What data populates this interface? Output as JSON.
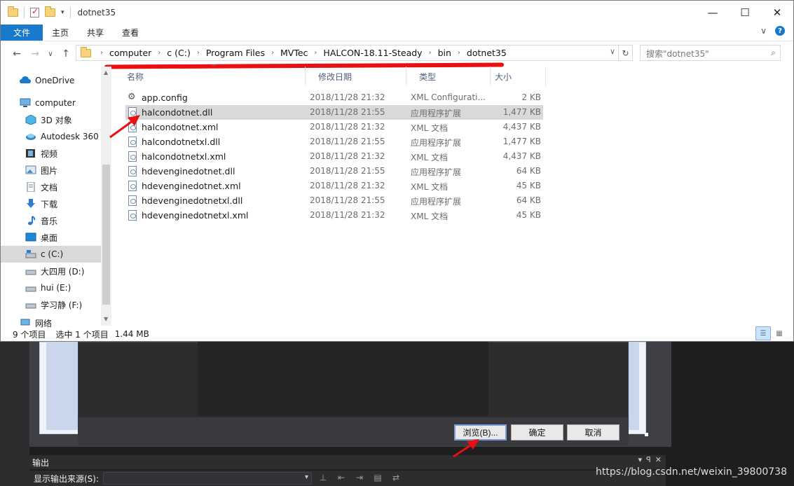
{
  "window": {
    "title": "dotnet35",
    "controls": {
      "minimize": "—",
      "maximize": "☐",
      "close": "✕"
    }
  },
  "ribbon": {
    "tabs": [
      "文件",
      "主页",
      "共享",
      "查看"
    ],
    "chevron": "∨",
    "help": "?"
  },
  "nav": {
    "back": "←",
    "forward": "→",
    "recent": "∨",
    "up": "↑",
    "breadcrumb": [
      "computer",
      "c (C:)",
      "Program Files",
      "MVTec",
      "HALCON-18.11-Steady",
      "bin",
      "dotnet35"
    ],
    "refresh": "↻",
    "search_placeholder": "搜索\"dotnet35\""
  },
  "sidebar": {
    "items": [
      {
        "label": "OneDrive",
        "icon": "cloud-icon"
      },
      {
        "label": "computer",
        "icon": "computer-icon"
      },
      {
        "label": "3D 对象",
        "icon": "cube-icon"
      },
      {
        "label": "Autodesk 360",
        "icon": "autodesk-icon"
      },
      {
        "label": "视频",
        "icon": "video-icon"
      },
      {
        "label": "图片",
        "icon": "picture-icon"
      },
      {
        "label": "文档",
        "icon": "document-icon"
      },
      {
        "label": "下载",
        "icon": "download-icon"
      },
      {
        "label": "音乐",
        "icon": "music-icon"
      },
      {
        "label": "桌面",
        "icon": "desktop-icon"
      },
      {
        "label": "c (C:)",
        "icon": "drive-icon"
      },
      {
        "label": "大四用 (D:)",
        "icon": "drive-icon"
      },
      {
        "label": "hui (E:)",
        "icon": "drive-icon"
      },
      {
        "label": "学习静 (F:)",
        "icon": "drive-icon"
      },
      {
        "label": "网络",
        "icon": "network-icon"
      }
    ]
  },
  "columns": {
    "name": "名称",
    "date": "修改日期",
    "type": "类型",
    "size": "大小"
  },
  "files": [
    {
      "name": "app.config",
      "date": "2018/11/28 21:32",
      "type": "XML Configurati...",
      "size": "2 KB"
    },
    {
      "name": "halcondotnet.dll",
      "date": "2018/11/28 21:55",
      "type": "应用程序扩展",
      "size": "1,477 KB"
    },
    {
      "name": "halcondotnet.xml",
      "date": "2018/11/28 21:32",
      "type": "XML 文档",
      "size": "4,437 KB"
    },
    {
      "name": "halcondotnetxl.dll",
      "date": "2018/11/28 21:55",
      "type": "应用程序扩展",
      "size": "1,477 KB"
    },
    {
      "name": "halcondotnetxl.xml",
      "date": "2018/11/28 21:32",
      "type": "XML 文档",
      "size": "4,437 KB"
    },
    {
      "name": "hdevenginedotnet.dll",
      "date": "2018/11/28 21:55",
      "type": "应用程序扩展",
      "size": "64 KB"
    },
    {
      "name": "hdevenginedotnet.xml",
      "date": "2018/11/28 21:32",
      "type": "XML 文档",
      "size": "45 KB"
    },
    {
      "name": "hdevenginedotnetxl.dll",
      "date": "2018/11/28 21:55",
      "type": "应用程序扩展",
      "size": "64 KB"
    },
    {
      "name": "hdevenginedotnetxl.xml",
      "date": "2018/11/28 21:32",
      "type": "XML 文档",
      "size": "45 KB"
    }
  ],
  "status": {
    "count": "9 个项目",
    "selected": "选中 1 个项目",
    "size": "1.44 MB"
  },
  "vs": {
    "buttons": {
      "browse": "浏览(B)...",
      "ok": "确定",
      "cancel": "取消"
    },
    "output_title": "输出",
    "output_source_label": "显示输出来源(S):",
    "output_tools": [
      "▾",
      "ꟼ",
      "✕"
    ]
  },
  "watermark": "https://blog.csdn.net/weixin_39800738",
  "colors": {
    "accent": "#1979ca",
    "annotation": "#e81010"
  }
}
